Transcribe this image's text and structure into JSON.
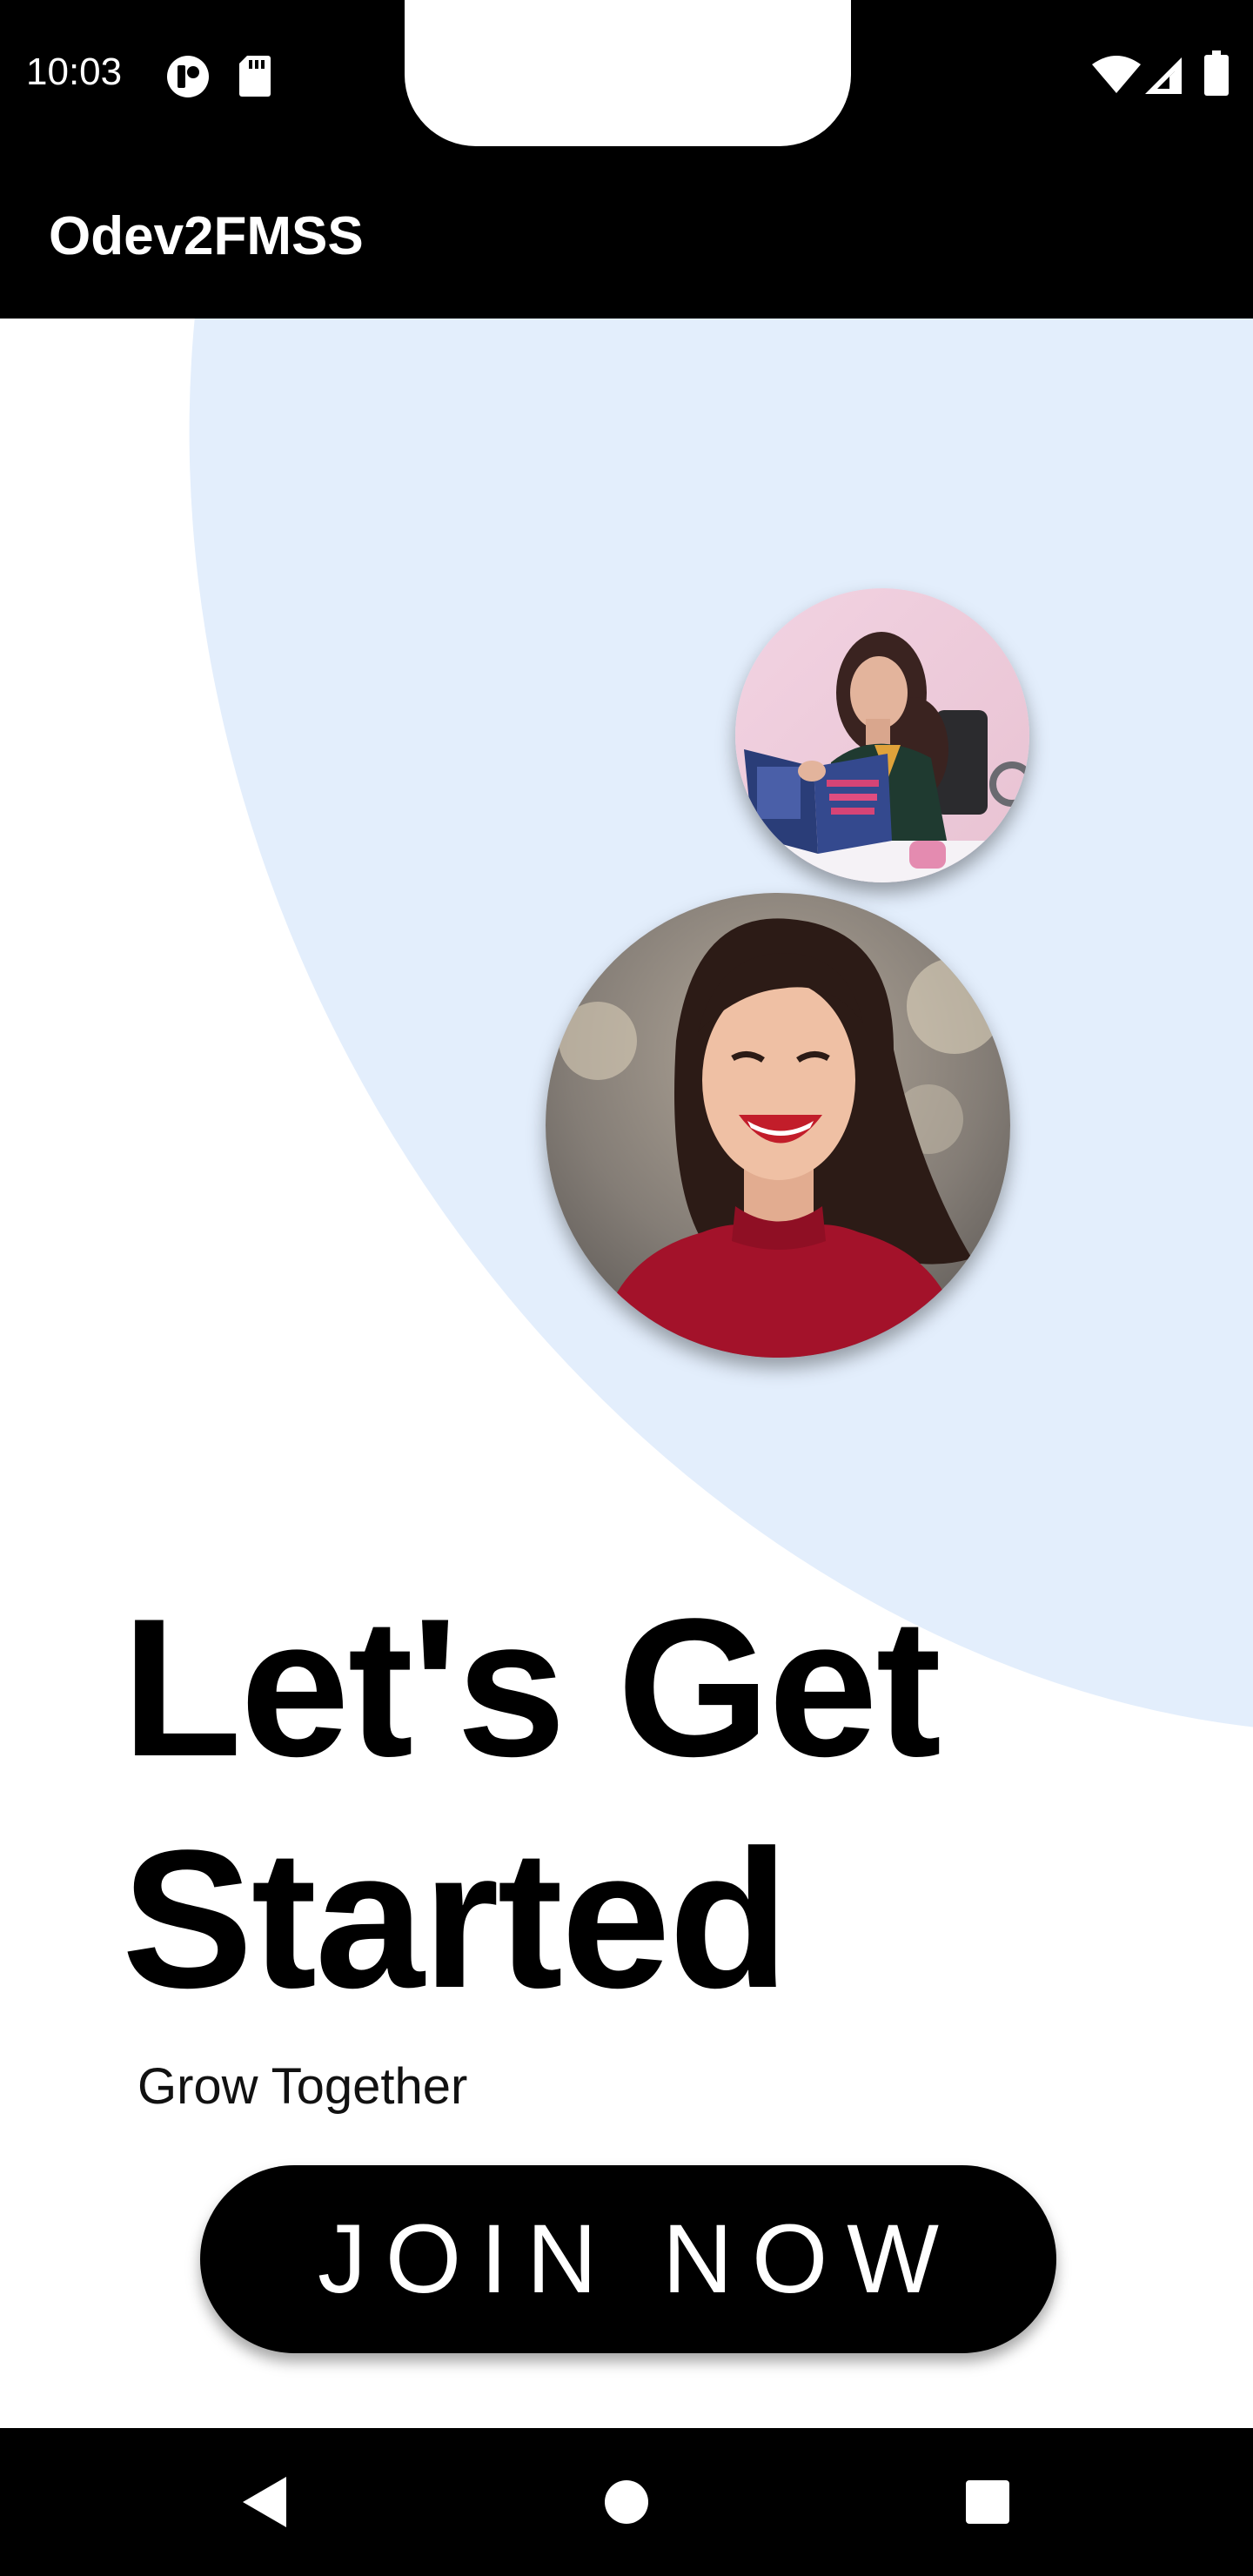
{
  "status_bar": {
    "time": "10:03",
    "icons": [
      "sync-notification-icon",
      "sd-card-icon",
      "wifi-icon",
      "cell-signal-icon",
      "battery-icon"
    ]
  },
  "app_bar": {
    "title": "Odev2FMSS"
  },
  "hero": {
    "headline_line1": "Let's Get",
    "headline_line2": "Started",
    "subline": "Grow Together",
    "button_label": "JOIN NOW"
  },
  "nav_bar": {
    "icons": [
      "back-icon",
      "home-icon",
      "recents-icon"
    ]
  },
  "colors": {
    "background": "#ffffff",
    "bars": "#000000",
    "blob": "#e3eefc",
    "button": "#000000",
    "button_text": "#ffffff"
  }
}
